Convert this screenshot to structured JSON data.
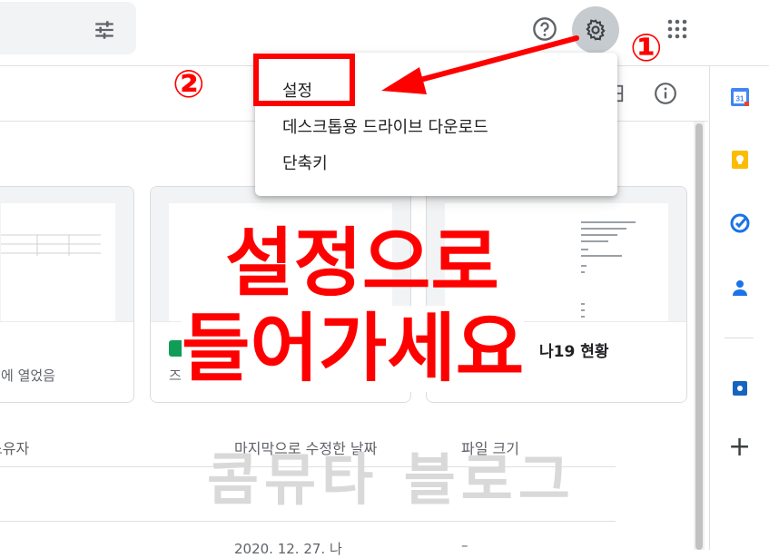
{
  "topbar": {
    "icons": [
      "filter-icon",
      "help-icon",
      "gear-icon",
      "apps-icon"
    ]
  },
  "menu": {
    "items": [
      "설정",
      "데스크톱용 드라이브 다운로드",
      "단축키"
    ]
  },
  "annotations": {
    "step1": "①",
    "step2": "②",
    "line1": "설정으로",
    "line2": "들어가세요",
    "color": "#ff0000"
  },
  "cards": {
    "left_caption": "에 열었음",
    "middle_caption": "즈",
    "right_caption": "나19 현황"
  },
  "list": {
    "headers": {
      "owner": "소유자",
      "modified": "마지막으로 수정한 날짜",
      "size": "파일 크기"
    },
    "rows": [
      {
        "modified": "2020. 12. 27. 나",
        "size": "–"
      }
    ]
  },
  "watermark": "콤뮤타 블로그",
  "side_panel": {
    "icons": [
      "calendar-icon",
      "keep-icon",
      "tasks-icon",
      "contacts-icon",
      "get-addons-icon",
      "add-icon"
    ],
    "calendar_day": "31",
    "add_label": "+"
  }
}
